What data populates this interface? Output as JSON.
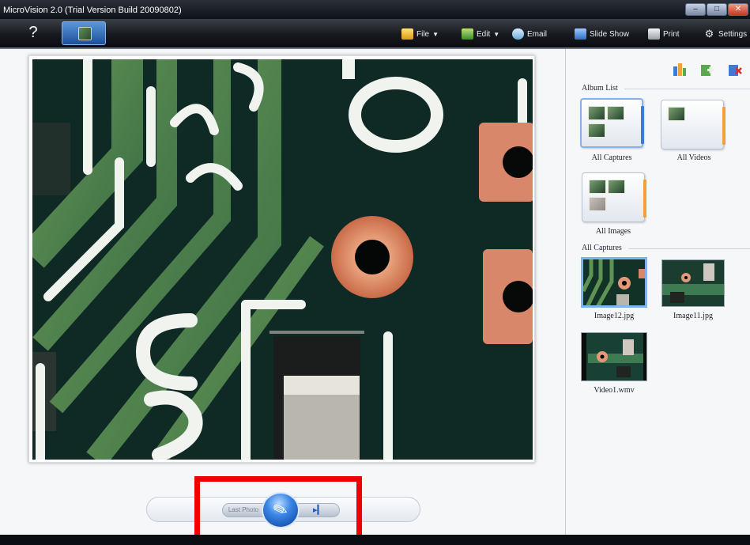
{
  "window": {
    "title": "MicroVision 2.0 (Trial Version Build 20090802)",
    "buttons": [
      "minimize",
      "maximize",
      "close"
    ]
  },
  "toolbar": {
    "help_icon": "question-icon",
    "camera_tab_icon": "camera-icon",
    "items": [
      {
        "label": "File",
        "icon": "folder-icon",
        "dropdown": true
      },
      {
        "label": "Edit",
        "icon": "edit-icon",
        "dropdown": true
      },
      {
        "label": "Email",
        "icon": "email-icon",
        "dropdown": false
      },
      {
        "label": "Slide Show",
        "icon": "slideshow-icon",
        "dropdown": false
      },
      {
        "label": "Print",
        "icon": "print-icon",
        "dropdown": false
      },
      {
        "label": "Settings",
        "icon": "gear-icon",
        "dropdown": false
      }
    ]
  },
  "controls": {
    "prev_label": "Last Photo",
    "next_glyph": "▸▎",
    "capture_icon": "capture-icon",
    "capture_glyph": "✎"
  },
  "panel": {
    "action_icons": [
      "add-album-icon",
      "add-item-icon",
      "remove-item-icon"
    ],
    "album_section_title": "Album List",
    "albums": [
      {
        "label": "All Captures",
        "selected": true
      },
      {
        "label": "All Videos",
        "selected": false
      },
      {
        "label": "All Images",
        "selected": false
      }
    ],
    "captures_section_title": "All Captures",
    "captures": [
      {
        "label": "Image12.jpg",
        "selected": true
      },
      {
        "label": "Image11.jpg",
        "selected": false
      },
      {
        "label": "Video1.wmv",
        "selected": false
      }
    ]
  },
  "colors": {
    "highlight": "#f20000",
    "selection": "#7fb2ee",
    "toolbar_bg": "#16191e",
    "pcb_green": "#3e7a52",
    "copper": "#e08a68"
  }
}
